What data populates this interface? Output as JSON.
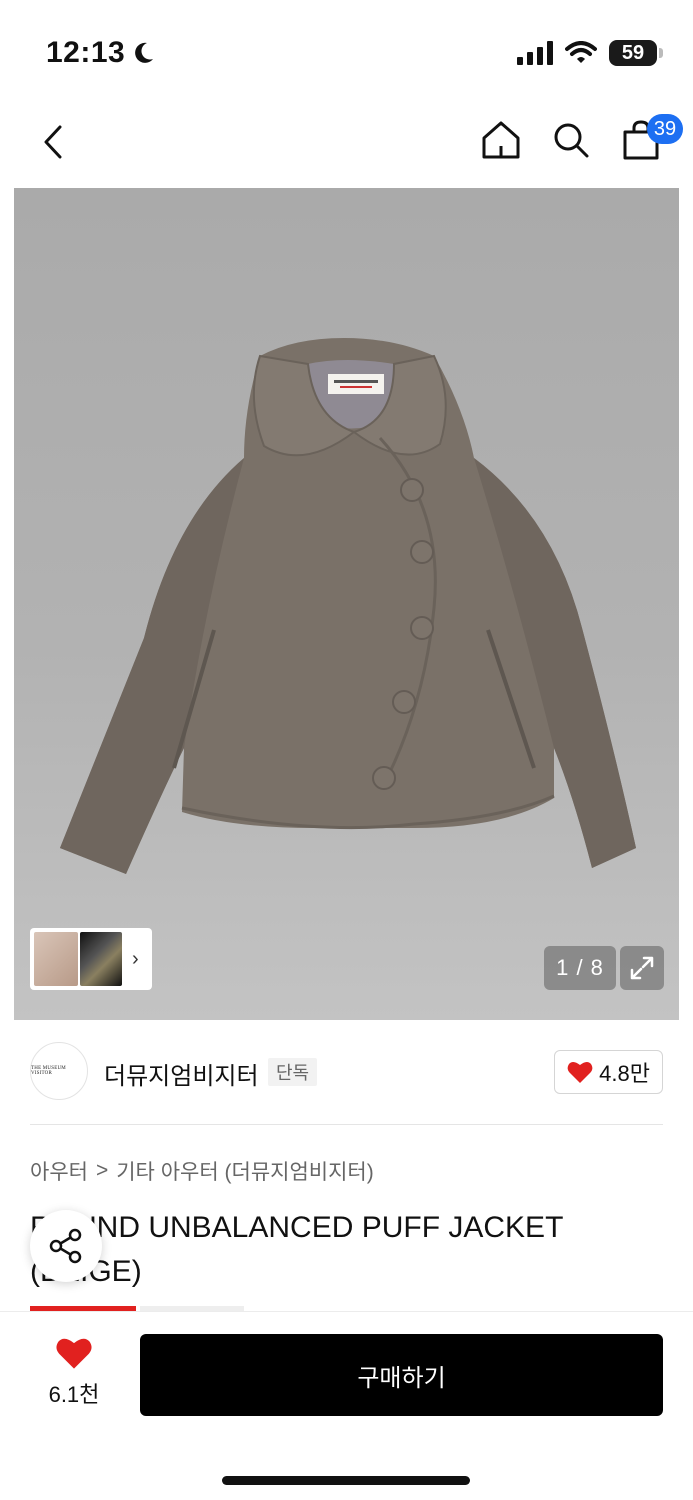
{
  "status_bar": {
    "time": "12:13",
    "battery": "59"
  },
  "nav": {
    "cart_count": "39"
  },
  "gallery": {
    "page_indicator": "1 / 8"
  },
  "brand": {
    "logo_text": "THE MUSEUM VISITOR",
    "name": "더뮤지엄비지터",
    "exclusive_label": "단독",
    "likes": "4.8만"
  },
  "breadcrumb": {
    "category": "아우터",
    "separator": ">",
    "subcategory": "기타 아우터 (더뮤지엄비지터)"
  },
  "product": {
    "title": "ROUND UNBALANCED PUFF JACKET (BEIGE)"
  },
  "bottom_bar": {
    "wish_count": "6.1천",
    "buy_label": "구매하기"
  },
  "colors": {
    "accent_blue": "#1d6ff2",
    "heart_red": "#e1211f",
    "buy_button": "#000000",
    "jacket": "#7a7168"
  }
}
